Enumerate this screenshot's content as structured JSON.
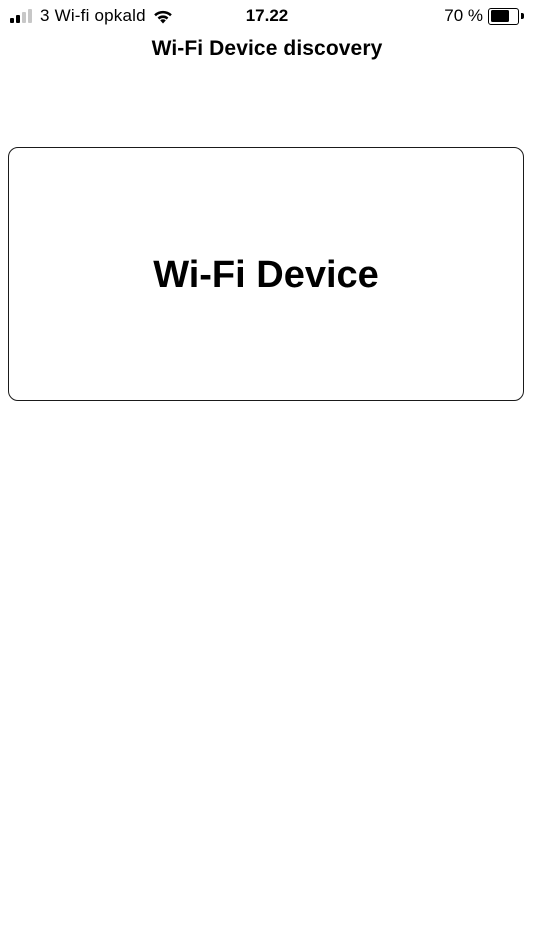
{
  "status_bar": {
    "carrier": "3 Wi-fi opkald",
    "time": "17.22",
    "battery_percent_text": "70 %",
    "battery_level": 0.7,
    "signal_bars_active": 2,
    "signal_bars_total": 4,
    "icons": [
      "signal-icon",
      "wifi-icon",
      "battery-icon"
    ]
  },
  "nav": {
    "title": "Wi-Fi Device discovery"
  },
  "devices": [
    {
      "label": "Wi-Fi Device"
    }
  ]
}
